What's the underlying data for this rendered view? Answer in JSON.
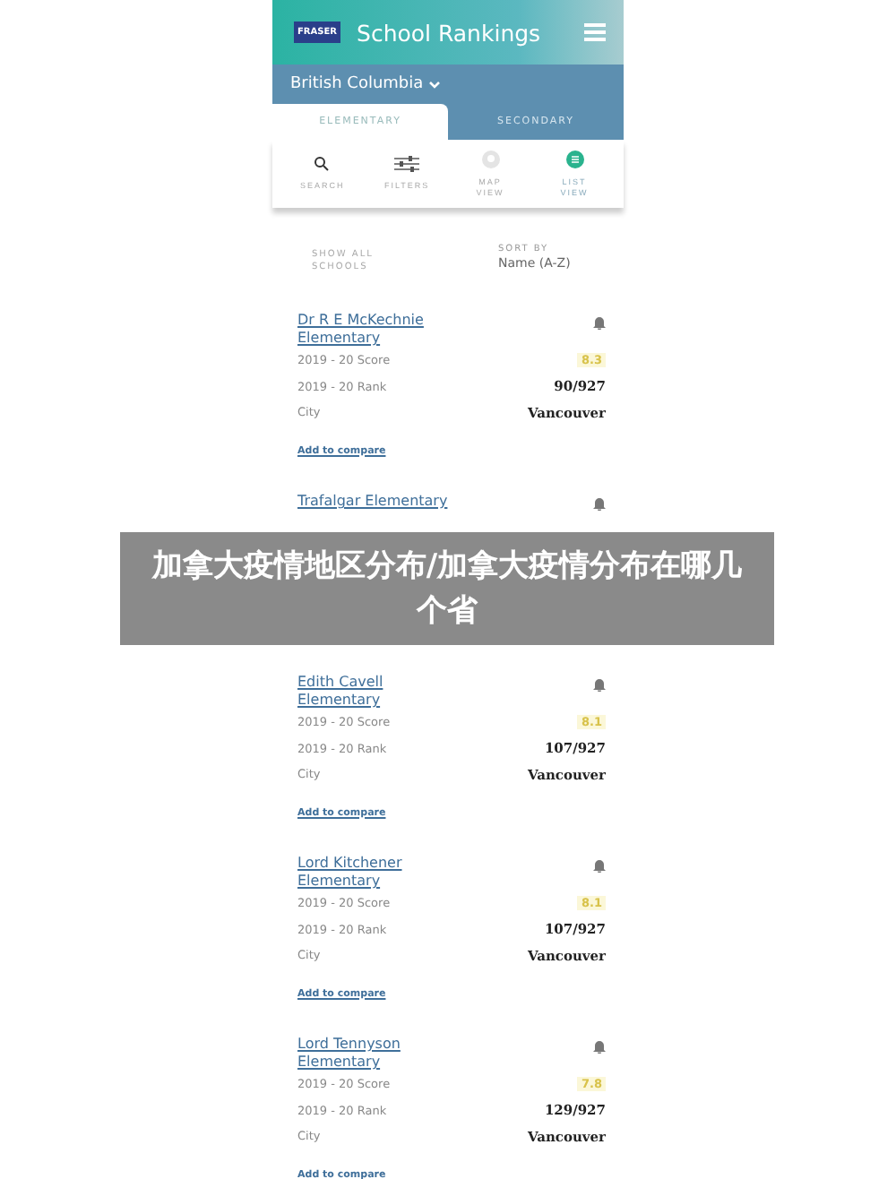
{
  "header": {
    "logo": "FRASER",
    "title": "School Rankings",
    "region": "British Columbia"
  },
  "tabs": [
    {
      "label": "ELEMENTARY",
      "selected": true
    },
    {
      "label": "SECONDARY",
      "selected": false
    }
  ],
  "toolbar": [
    {
      "kind": "search",
      "label": "SEARCH",
      "selected": false
    },
    {
      "kind": "filters",
      "label": "FILTERS",
      "selected": false
    },
    {
      "kind": "map",
      "label": "MAP VIEW",
      "selected": false
    },
    {
      "kind": "list",
      "label": "LIST VIEW",
      "selected": true
    }
  ],
  "show_all": "SHOW ALL SCHOOLS",
  "sort": {
    "label": "SORT BY",
    "value": "Name (A-Z)"
  },
  "schools": [
    {
      "name": "Dr R E McKechnie Elementary",
      "score_label": "2019 - 20 Score",
      "score": "8.3",
      "rank_label": "2019 - 20 Rank",
      "rank": "90/927",
      "city_label": "City",
      "city": "Vancouver",
      "link": "Add to compare"
    },
    {
      "name": "Trafalgar Elementary"
    },
    {
      "name": "Edith Cavell Elementary",
      "score_label": "2019 - 20 Score",
      "score": "8.1",
      "rank_label": "2019 - 20 Rank",
      "rank": "107/927",
      "city_label": "City",
      "city": "Vancouver",
      "link": "Add to compare"
    },
    {
      "name": "Lord Kitchener Elementary",
      "score_label": "2019 - 20 Score",
      "score": "8.1",
      "rank_label": "2019 - 20 Rank",
      "rank": "107/927",
      "city_label": "City",
      "city": "Vancouver",
      "link": "Add to compare"
    },
    {
      "name": "Lord Tennyson Elementary",
      "score_label": "2019 - 20 Score",
      "score": "7.8",
      "rank_label": "2019 - 20 Rank",
      "rank": "129/927",
      "city_label": "City",
      "city": "Vancouver",
      "link": "Add to compare"
    }
  ],
  "overlay_caption": "加拿大疫情地区分布/加拿大疫情分布在哪几个省"
}
